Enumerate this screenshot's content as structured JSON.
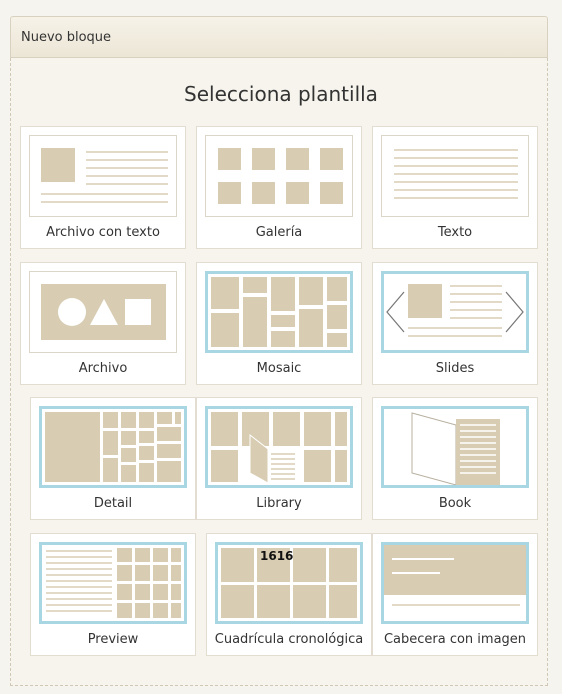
{
  "header": {
    "title": "Nuevo bloque"
  },
  "main": {
    "heading": "Selecciona plantilla",
    "templates": [
      {
        "label": "Archivo con texto"
      },
      {
        "label": "Galería"
      },
      {
        "label": "Texto"
      },
      {
        "label": "Archivo"
      },
      {
        "label": "Mosaic"
      },
      {
        "label": "Slides"
      },
      {
        "label": "Detail"
      },
      {
        "label": "Library"
      },
      {
        "label": "Book"
      },
      {
        "label": "Preview"
      },
      {
        "label": "Cuadrícula cronológica",
        "thumb_text": "1616"
      },
      {
        "label": "Cabecera con imagen"
      }
    ]
  },
  "colors": {
    "accent": "#a8d6e2",
    "placeholder": "#d8cdb3",
    "background": "#f6f4ee"
  }
}
